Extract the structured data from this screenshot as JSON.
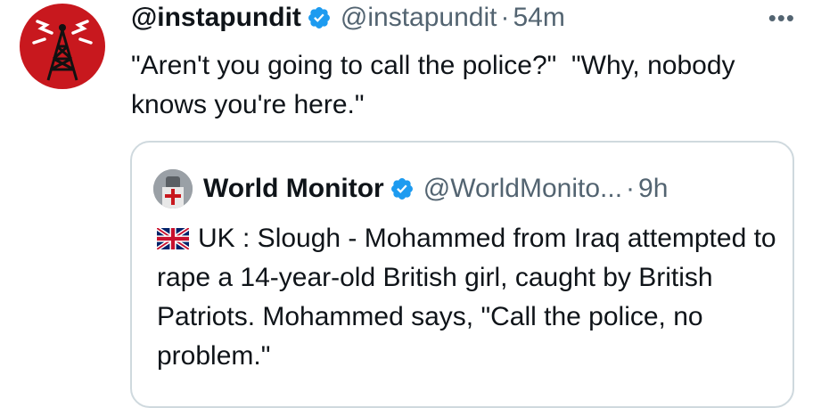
{
  "tweet": {
    "author_name": "@instapundit",
    "handle": "@instapundit",
    "separator": "·",
    "time": "54m",
    "text": "\"Aren't you going to call the police?\"  \"Why, nobody knows you're here.\"",
    "more_icon": "ellipsis-icon",
    "verified_icon": "verified-badge-icon"
  },
  "quoted_tweet": {
    "author_name": "World Monitor",
    "handle": "@WorldMonito...",
    "separator": "·",
    "time": "9h",
    "flag_icon": "uk-flag-icon",
    "text": "UK : Slough - Mohammed from Iraq attempted to rape a 14-year-old British girl, caught by British Patriots. Mohammed says, \"Call the police, no problem.\""
  },
  "colors": {
    "verified_blue": "#1d9bf0",
    "avatar_red": "#c8181e",
    "muted_text": "#536471",
    "border": "#cfd9de"
  }
}
